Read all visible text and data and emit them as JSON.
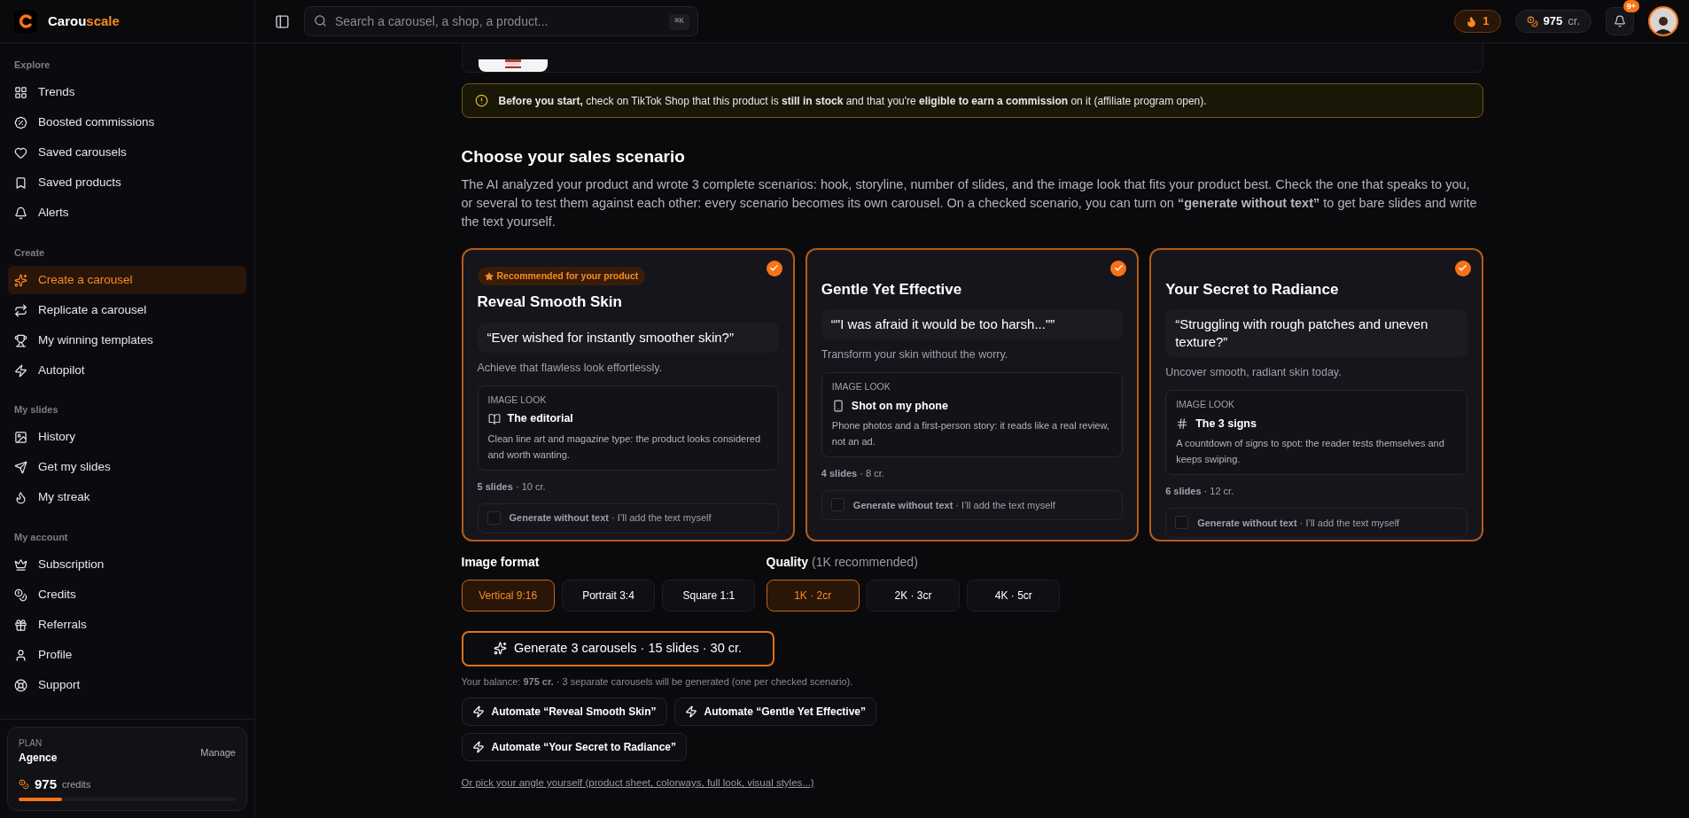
{
  "brand": {
    "first": "Carou",
    "second": "scale"
  },
  "search": {
    "placeholder": "Search a carousel, a shop, a product...",
    "shortcut": "⌘K"
  },
  "header": {
    "streak": "1",
    "credits": "975",
    "credits_unit": "cr.",
    "notifications": "9+"
  },
  "sidebar": {
    "sections": [
      {
        "title": "Explore",
        "items": [
          {
            "label": "Trends",
            "selected": false
          },
          {
            "label": "Boosted commissions",
            "selected": false
          },
          {
            "label": "Saved carousels",
            "selected": false
          },
          {
            "label": "Saved products",
            "selected": false
          },
          {
            "label": "Alerts",
            "selected": false
          }
        ]
      },
      {
        "title": "Create",
        "items": [
          {
            "label": "Create a carousel",
            "selected": true
          },
          {
            "label": "Replicate a carousel",
            "selected": false
          },
          {
            "label": "My winning templates",
            "selected": false
          },
          {
            "label": "Autopilot",
            "selected": false
          }
        ]
      },
      {
        "title": "My slides",
        "items": [
          {
            "label": "History",
            "selected": false
          },
          {
            "label": "Get my slides",
            "selected": false
          },
          {
            "label": "My streak",
            "selected": false
          }
        ]
      },
      {
        "title": "My account",
        "items": [
          {
            "label": "Subscription",
            "selected": false
          },
          {
            "label": "Credits",
            "selected": false
          },
          {
            "label": "Referrals",
            "selected": false
          },
          {
            "label": "Profile",
            "selected": false
          },
          {
            "label": "Support",
            "selected": false
          }
        ]
      }
    ],
    "plan": {
      "label": "PLAN",
      "name": "Agence",
      "manage": "Manage",
      "credits": "975",
      "credits_label": "credits",
      "level": 0.2
    }
  },
  "product": {
    "kind": "picture"
  },
  "alert": "**Before you start,** check on TikTok Shop that this product is **still in stock** and that you're **eligible to earn a commission** on it (affiliate program open).",
  "scenario_heading": "Choose your sales scenario",
  "scenario_description": "The AI analyzed your product and wrote 3 complete scenarios: hook, storyline, number of slides, and the image look that fits your product best. Check the one that speaks to you, or several to test them against each other: every scenario becomes its own carousel. On a checked scenario, you can turn on **“generate without text”** to get bare slides and write the text yourself.",
  "scenarios": [
    {
      "badge": "Recommended for your product",
      "title": "Reveal Smooth Skin",
      "hook": "“Ever wished for instantly smoother skin?”",
      "subtitle": "Achieve that flawless look effortlessly.",
      "look_label": "IMAGE LOOK",
      "look_name": "The editorial",
      "look_description": "Clean line art and magazine type: the product looks considered and worth wanting.",
      "meta": "**5 slides** · 10 cr.",
      "no_text": "**Generate without text** · I’ll add the text myself",
      "no_text_checked": false,
      "checked": true
    },
    {
      "title": "Gentle Yet Effective",
      "hook": "“\"I was afraid it would be too harsh...\"”",
      "subtitle": "Transform your skin without the worry.",
      "look_label": "IMAGE LOOK",
      "look_name": "Shot on my phone",
      "look_description": "Phone photos and a first-person story: it reads like a real review, not an ad.",
      "meta": "**4 slides** · 8 cr.",
      "no_text": "**Generate without text** · I’ll add the text myself",
      "no_text_checked": false,
      "checked": true
    },
    {
      "title": "Your Secret to Radiance",
      "hook": "“Struggling with rough patches and uneven texture?”",
      "subtitle": "Uncover smooth, radiant skin today.",
      "look_label": "IMAGE LOOK",
      "look_name": "The 3 signs",
      "look_description": "A countdown of signs to spot: the reader tests themselves and keeps swiping.",
      "meta": "**6 slides** · 12 cr.",
      "no_text": "**Generate without text** · I’ll add the text myself",
      "no_text_checked": false,
      "checked": true
    }
  ],
  "image_format": {
    "label": "Image format",
    "options": [
      {
        "label": "Vertical 9:16",
        "selected": true
      },
      {
        "label": "Portrait 3:4",
        "selected": false
      },
      {
        "label": "Square 1:1",
        "selected": false
      }
    ]
  },
  "quality": {
    "label": "Quality",
    "hint": "(1K recommended)",
    "options": [
      {
        "label": "1K · 2cr",
        "selected": true
      },
      {
        "label": "2K · 3cr",
        "selected": false
      },
      {
        "label": "4K · 5cr",
        "selected": false
      }
    ]
  },
  "generate_button": "Generate 3 carousels · 15 slides · 30 cr.",
  "balance_note": "Your balance: **975 cr.** · 3 separate carousels will be generated (one per checked scenario).",
  "automate_buttons": [
    "Automate “Reveal Smooth Skin”",
    "Automate “Gentle Yet Effective”",
    "Automate “Your Secret to Radiance”"
  ],
  "manual_link": "Or pick your angle yourself (product sheet, colorways, full look, visual styles...)"
}
